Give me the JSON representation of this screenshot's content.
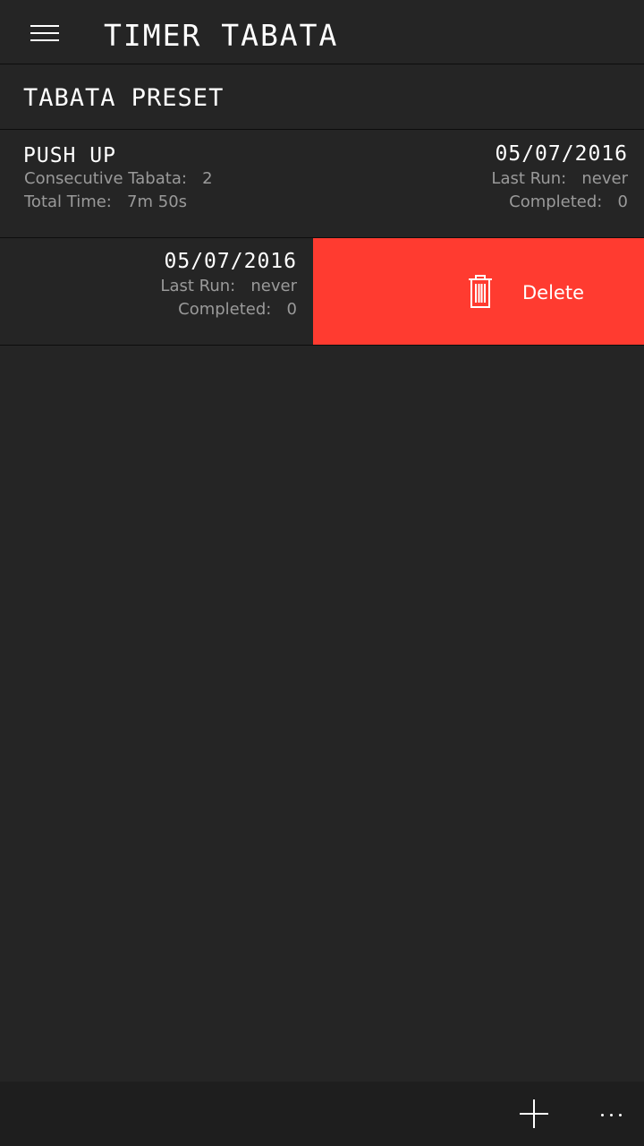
{
  "header": {
    "title": "TIMER TABATA",
    "menu_icon": "hamburger-menu-icon"
  },
  "section": {
    "title": "TABATA PRESET"
  },
  "presets": [
    {
      "name": "PUSH UP",
      "consecutive_label": "Consecutive Tabata:",
      "consecutive_value": "2",
      "total_time_label": "Total Time:",
      "total_time_value": "7m 50s",
      "date": "05/07/2016",
      "last_run_label": "Last Run:",
      "last_run_value": "never",
      "completed_label": "Completed:",
      "completed_value": "0"
    },
    {
      "date": "05/07/2016",
      "last_run_label": "Last Run:",
      "last_run_value": "never",
      "completed_label": "Completed:",
      "completed_value": "0",
      "delete_label": "Delete",
      "delete_icon": "trash-icon",
      "delete_color": "#ff3b30"
    }
  ],
  "bottom_bar": {
    "add_icon": "plus-icon",
    "more_icon": "more-ellipsis-icon"
  },
  "colors": {
    "background": "#252525",
    "secondary_text": "#9a9a9a",
    "bottom_bar": "#1e1e1e"
  }
}
